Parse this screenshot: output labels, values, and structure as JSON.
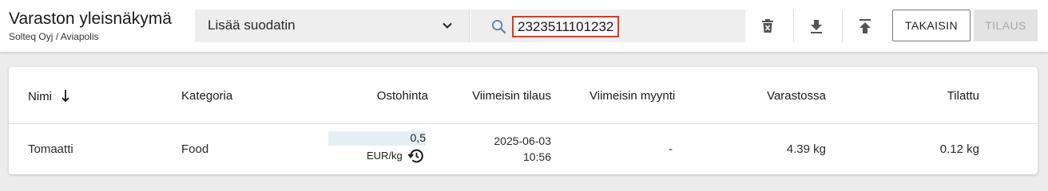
{
  "header": {
    "title": "Varaston yleisnäkymä",
    "subtitle": "Solteq Oyj / Aviapolis"
  },
  "toolbar": {
    "filter_placeholder": "Lisää suodatin",
    "search_value": "2323511101232",
    "delete_icon": "trash-icon",
    "download_icon": "download-icon",
    "upload_icon": "upload-icon",
    "back_label": "TAKAISIN",
    "order_label": "TILAUS"
  },
  "table": {
    "columns": [
      "Nimi",
      "Kategoria",
      "Ostohinta",
      "Viimeisin tilaus",
      "Viimeisin myynti",
      "Varastossa",
      "Tilattu"
    ],
    "sort_icon": "arrow-down-icon",
    "rows": [
      {
        "name": "Tomaatti",
        "category": "Food",
        "price": "0,5",
        "price_unit": "EUR/kg",
        "last_order_date": "2025-06-03",
        "last_order_time": "10:56",
        "last_sale": "-",
        "in_stock": "4.39 kg",
        "ordered": "0.12 kg"
      }
    ]
  },
  "colors": {
    "highlight": "#e8331c",
    "price_bar": "#e3eff3",
    "background": "#ececec"
  }
}
